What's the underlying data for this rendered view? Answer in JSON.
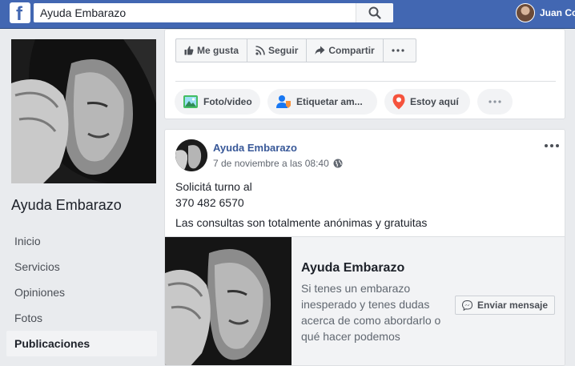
{
  "topbar": {
    "logo_letter": "f",
    "search_value": "Ayuda Embarazo",
    "user_name": "Juan Co"
  },
  "page": {
    "name": "Ayuda Embarazo",
    "nav": [
      {
        "label": "Inicio",
        "active": false
      },
      {
        "label": "Servicios",
        "active": false
      },
      {
        "label": "Opiniones",
        "active": false
      },
      {
        "label": "Fotos",
        "active": false
      },
      {
        "label": "Publicaciones",
        "active": true
      }
    ]
  },
  "actions": {
    "like": "Me gusta",
    "follow": "Seguir",
    "share": "Compartir",
    "photo_video": "Foto/video",
    "tag": "Etiquetar am...",
    "checkin": "Estoy aquí"
  },
  "post": {
    "author": "Ayuda Embarazo",
    "time": "7 de noviembre a las 08:40",
    "lines": [
      "Solicitá turno al",
      "370 482 6570",
      "Las consultas son totalmente anónimas y gratuitas"
    ]
  },
  "message_card": {
    "title": "Ayuda Embarazo",
    "description": "Si tenes un embarazo inesperado y tenes dudas acerca de como abordarlo o qué hacer podemos",
    "button": "Enviar mensaje"
  },
  "colors": {
    "brand": "#4267b2",
    "link": "#385898",
    "background": "#e9ebee"
  }
}
